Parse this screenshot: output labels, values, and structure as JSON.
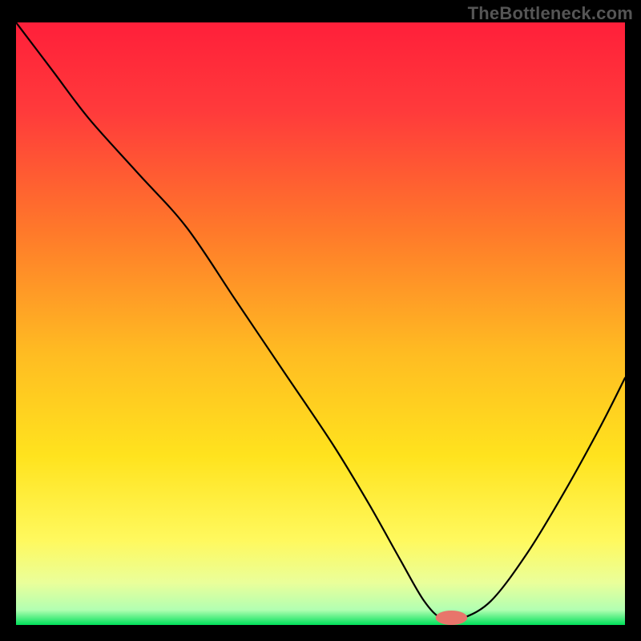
{
  "watermark": "TheBottleneck.com",
  "chart_data": {
    "type": "line",
    "title": "",
    "xlabel": "",
    "ylabel": "",
    "xlim": [
      0,
      100
    ],
    "ylim": [
      0,
      100
    ],
    "grid": false,
    "legend": false,
    "gradient": {
      "stops": [
        {
          "offset": 0.0,
          "color": "#ff1f3a"
        },
        {
          "offset": 0.15,
          "color": "#ff3b3b"
        },
        {
          "offset": 0.35,
          "color": "#ff7a2a"
        },
        {
          "offset": 0.55,
          "color": "#ffbc22"
        },
        {
          "offset": 0.72,
          "color": "#ffe31e"
        },
        {
          "offset": 0.86,
          "color": "#fff95e"
        },
        {
          "offset": 0.93,
          "color": "#eaff9a"
        },
        {
          "offset": 0.975,
          "color": "#b2ffb2"
        },
        {
          "offset": 1.0,
          "color": "#00e05a"
        }
      ]
    },
    "series": [
      {
        "name": "bottleneck-curve",
        "stroke": "#000000",
        "stroke_width": 2.2,
        "x": [
          0,
          6,
          12,
          20,
          28,
          36,
          44,
          52,
          58,
          63,
          67,
          70,
          73,
          78,
          84,
          90,
          96,
          100
        ],
        "y": [
          100,
          92,
          84,
          75,
          66,
          54,
          42,
          30,
          20,
          11,
          4,
          1,
          1,
          4,
          12,
          22,
          33,
          41
        ]
      }
    ],
    "marker": {
      "name": "target-marker",
      "x": 71.5,
      "y": 1.2,
      "rx": 2.6,
      "ry": 1.2,
      "fill": "#e8756b"
    }
  }
}
